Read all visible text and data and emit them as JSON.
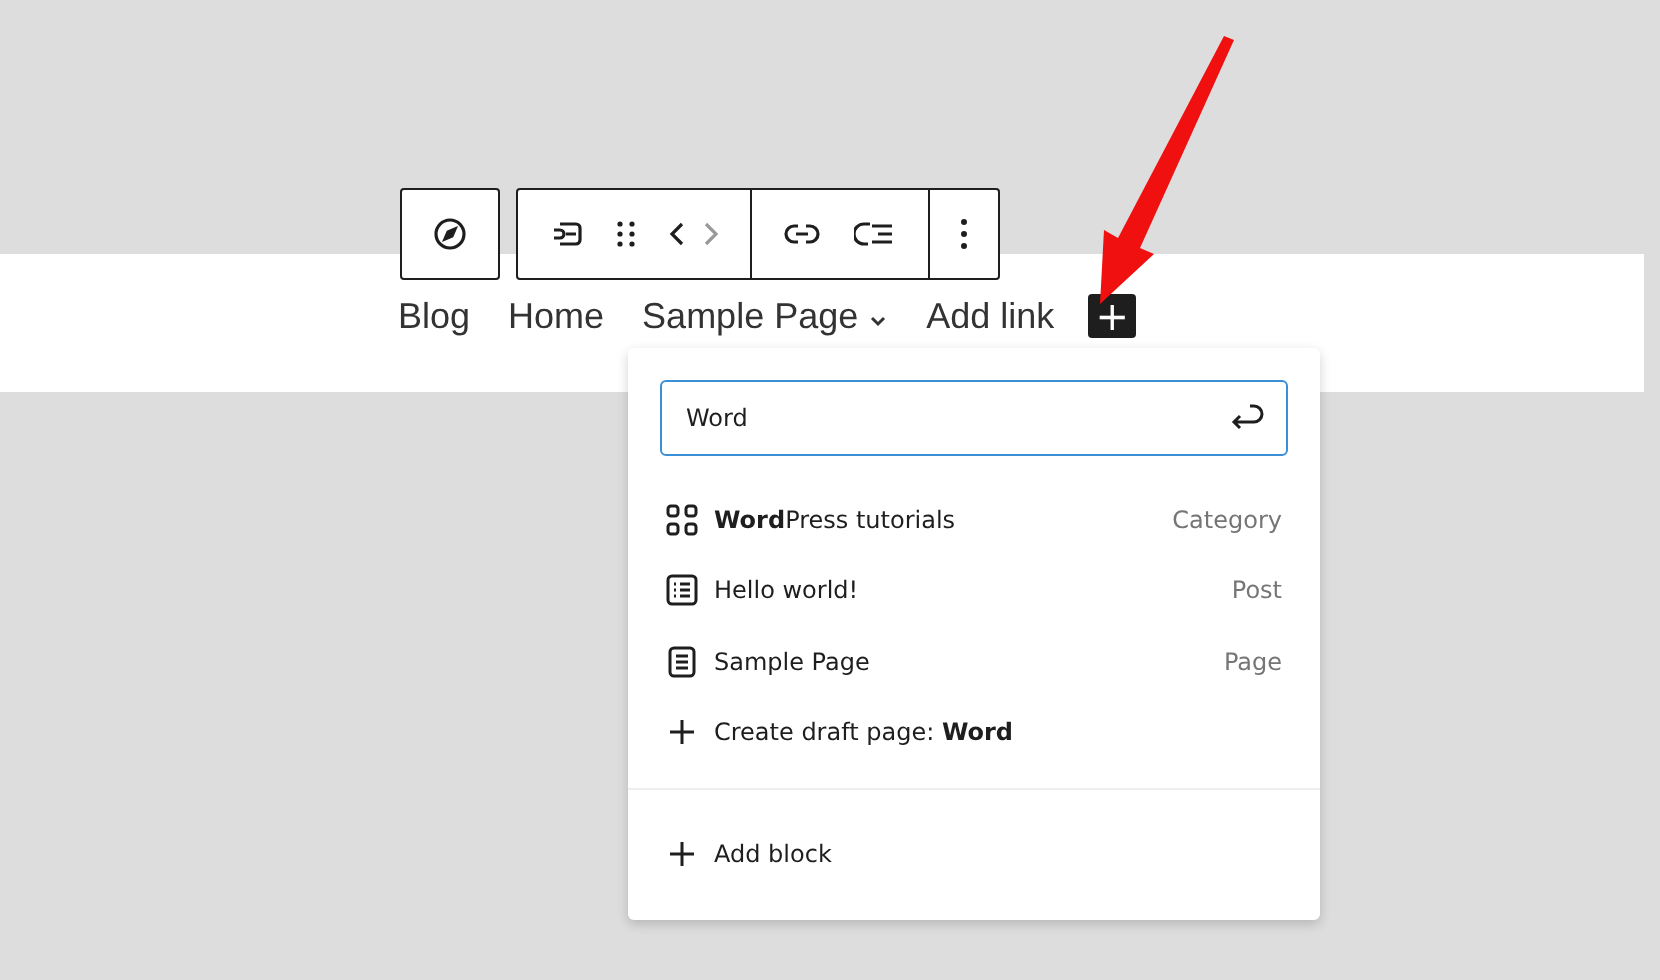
{
  "navigation": {
    "items": [
      {
        "label": "Blog",
        "has_submenu": false
      },
      {
        "label": "Home",
        "has_submenu": false
      },
      {
        "label": "Sample Page",
        "has_submenu": true
      },
      {
        "label": "Add link",
        "has_submenu": false
      }
    ],
    "add_button": "+"
  },
  "link_popup": {
    "search": {
      "value": "Word"
    },
    "results": [
      {
        "kind": "category",
        "title": "**Word**Press tutorials",
        "type": "Category"
      },
      {
        "kind": "post",
        "title": "Hello world!",
        "type": "Post"
      },
      {
        "kind": "page",
        "title": "Sample Page",
        "type": "Page"
      },
      {
        "kind": "create",
        "title": "Create draft page: **Word**"
      }
    ],
    "add_block": "Add block"
  }
}
